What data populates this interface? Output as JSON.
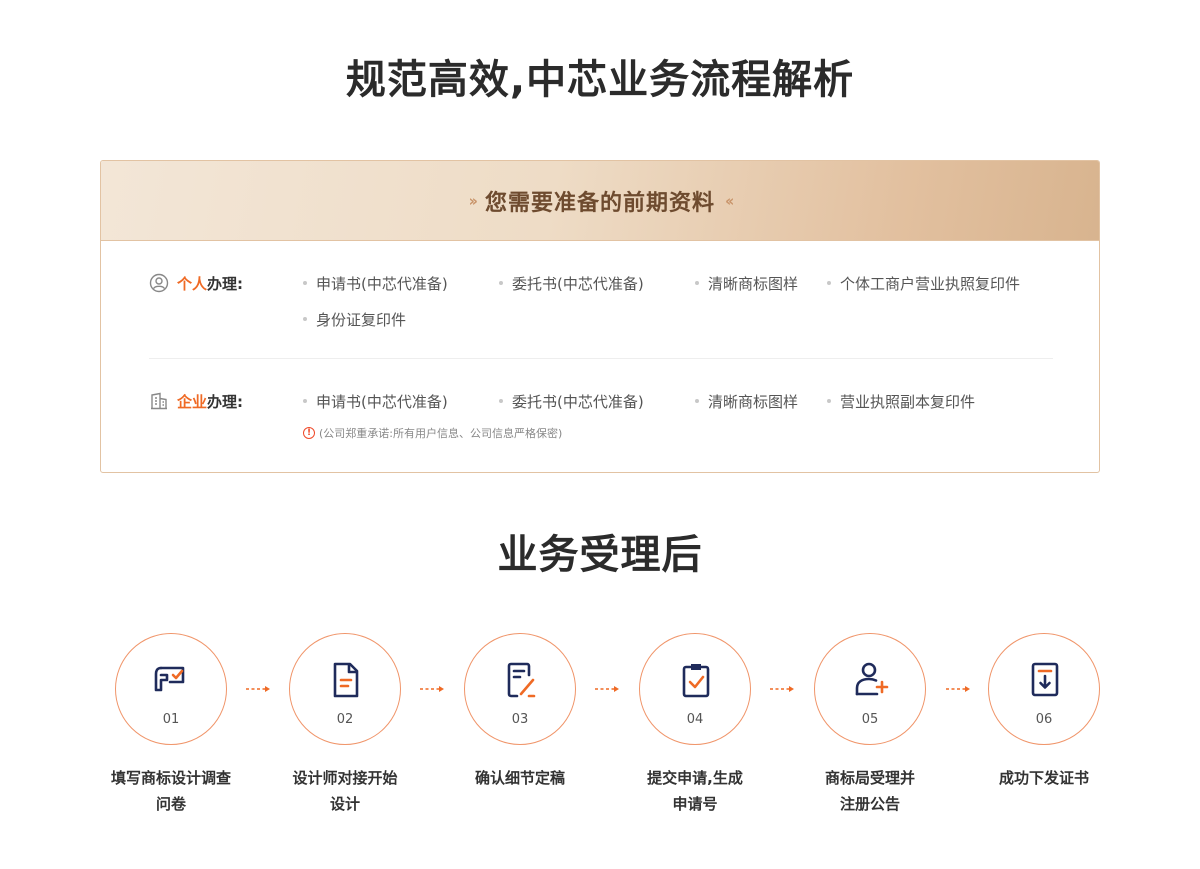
{
  "main_title": "规范高效,中芯业务流程解析",
  "prep": {
    "title": "您需要准备的前期资料",
    "personal": {
      "label_highlight": "个人",
      "label_rest": "办理:",
      "items": [
        "申请书(中芯代准备)",
        "委托书(中芯代准备)",
        "清晰商标图样",
        "个体工商户营业执照复印件",
        "身份证复印件"
      ]
    },
    "company": {
      "label_highlight": "企业",
      "label_rest": "办理:",
      "items": [
        "申请书(中芯代准备)",
        "委托书(中芯代准备)",
        "清晰商标图样",
        "营业执照副本复印件"
      ],
      "note": "(公司郑重承诺:所有用户信息、公司信息严格保密)"
    }
  },
  "process": {
    "title": "业务受理后",
    "steps": [
      {
        "num": "01",
        "label_line1": "填写商标设计调查",
        "label_line2": "问卷",
        "icon": "survey-icon"
      },
      {
        "num": "02",
        "label_line1": "设计师对接开始",
        "label_line2": "设计",
        "icon": "document-icon"
      },
      {
        "num": "03",
        "label_line1": "确认细节定稿",
        "label_line2": "",
        "icon": "edit-document-icon"
      },
      {
        "num": "04",
        "label_line1": "提交申请,生成",
        "label_line2": "申请号",
        "icon": "clipboard-check-icon"
      },
      {
        "num": "05",
        "label_line1": "商标局受理并",
        "label_line2": "注册公告",
        "icon": "add-user-icon"
      },
      {
        "num": "06",
        "label_line1": "成功下发证书",
        "label_line2": "",
        "icon": "certificate-download-icon"
      }
    ]
  },
  "colors": {
    "accent": "#ef6a25",
    "navy": "#1f2b5b",
    "gold_text": "#6e4b2f",
    "border": "#e2c3a3"
  }
}
